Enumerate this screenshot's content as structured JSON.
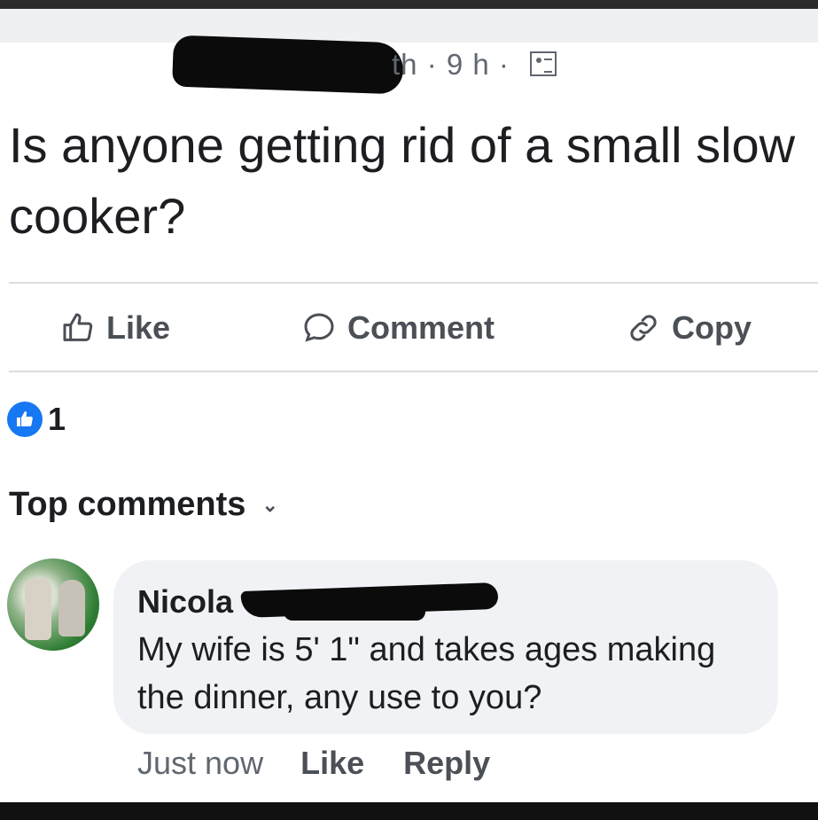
{
  "post": {
    "author_fragment": "th",
    "time": "· 9 h ·",
    "text": "Is anyone getting rid of a small slow cooker?"
  },
  "actions": {
    "like": "Like",
    "comment": "Comment",
    "copy": "Copy"
  },
  "reactions": {
    "count": "1"
  },
  "comments_header": {
    "label": "Top comments"
  },
  "comment": {
    "author": "Nicola",
    "text": "My wife  is 5' 1\" and takes ages making the dinner, any use to you?",
    "time": "Just now",
    "like": "Like",
    "reply": "Reply"
  },
  "icons": {
    "audience": "members-icon",
    "like": "thumbs-up-icon",
    "comment": "speech-bubble-icon",
    "copy": "link-icon",
    "reaction": "like-reaction-icon",
    "chevron": "chevron-down-icon"
  },
  "colors": {
    "reaction_blue": "#1877f2",
    "text_primary": "#1c1e21",
    "text_secondary": "#606770",
    "bubble_bg": "#f0f2f5"
  }
}
